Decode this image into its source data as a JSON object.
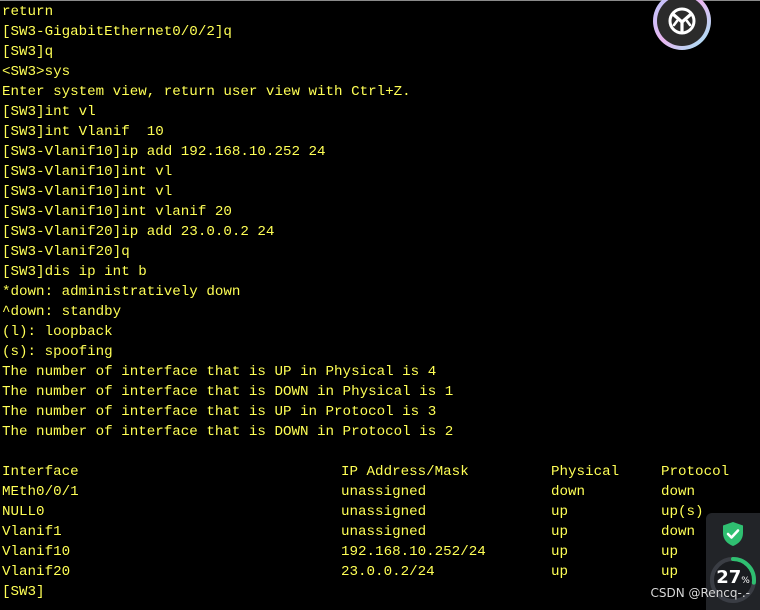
{
  "terminal": {
    "lines": [
      "return",
      "[SW3-GigabitEthernet0/0/2]q",
      "[SW3]q",
      "<SW3>sys",
      "Enter system view, return user view with Ctrl+Z.",
      "[SW3]int vl",
      "[SW3]int Vlanif  10",
      "[SW3-Vlanif10]ip add 192.168.10.252 24",
      "[SW3-Vlanif10]int vl",
      "[SW3-Vlanif10]int vl",
      "[SW3-Vlanif10]int vlanif 20",
      "[SW3-Vlanif20]ip add 23.0.0.2 24",
      "[SW3-Vlanif20]q",
      "[SW3]dis ip int b",
      "*down: administratively down",
      "^down: standby",
      "(l): loopback",
      "(s): spoofing",
      "The number of interface that is UP in Physical is 4",
      "The number of interface that is DOWN in Physical is 1",
      "The number of interface that is UP in Protocol is 3",
      "The number of interface that is DOWN in Protocol is 2",
      ""
    ],
    "table": {
      "headers": [
        "Interface",
        "IP Address/Mask",
        "Physical",
        "Protocol"
      ],
      "rows": [
        [
          "MEth0/0/1",
          "unassigned",
          "down",
          "down"
        ],
        [
          "NULL0",
          "unassigned",
          "up",
          "up(s)"
        ],
        [
          "Vlanif1",
          "unassigned",
          "up",
          "down"
        ],
        [
          "Vlanif10",
          "192.168.10.252/24",
          "up",
          "up"
        ],
        [
          "Vlanif20",
          "23.0.0.2/24",
          "up",
          "up"
        ]
      ]
    },
    "prompt": "[SW3]"
  },
  "overlay": {
    "logo_icon": "app-logo-icon",
    "security_icon": "shield-check-icon",
    "usage_value": "27",
    "usage_unit": "%",
    "watermark": "CSDN @Rencq-.-"
  },
  "colors": {
    "background": "#000000",
    "terminal_text": "#ffff55",
    "shield": "#2fbf71",
    "ring": "#2fbf71"
  }
}
